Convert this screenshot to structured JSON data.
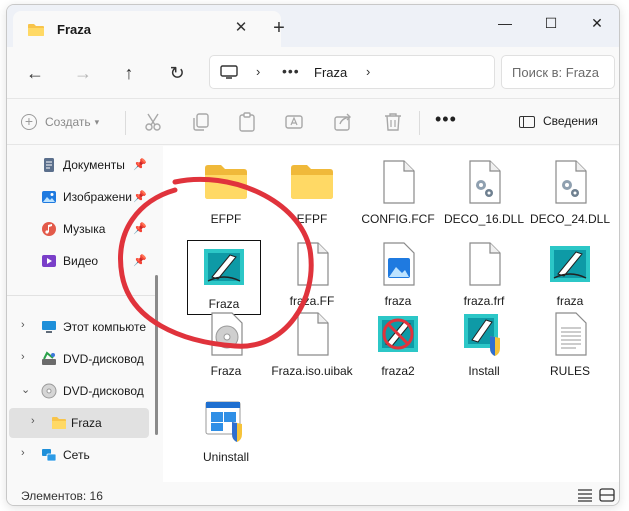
{
  "window": {
    "tab_title": "Fraza",
    "tab_close": "✕",
    "new_tab": "+",
    "minimize": "—",
    "maximize": "☐",
    "close": "✕"
  },
  "nav": {
    "back": "←",
    "forward": "→",
    "up": "↑",
    "refresh": "↻",
    "breadcrumb_more": "•••",
    "breadcrumb_segment": "Fraza",
    "breadcrumb_sep": "›",
    "search_placeholder": "Поиск в: Fraza"
  },
  "commands": {
    "create_label": "Создать",
    "more": "•••",
    "details_label": "Сведения"
  },
  "sidebar": {
    "quick": [
      {
        "label": "Документы",
        "icon": "documents-icon"
      },
      {
        "label": "Изображени",
        "icon": "pictures-icon"
      },
      {
        "label": "Музыка",
        "icon": "music-icon"
      },
      {
        "label": "Видео",
        "icon": "video-icon"
      }
    ],
    "tree": [
      {
        "label": "Этот компьюте",
        "icon": "this-pc-icon",
        "expander": "›"
      },
      {
        "label": "DVD-дисковод (",
        "icon": "dvd-drive-icon",
        "expander": "›"
      },
      {
        "label": "DVD-дисковод (",
        "icon": "dvd-disc-icon",
        "expander": "⌄"
      },
      {
        "label": "Fraza",
        "icon": "folder-icon",
        "expander": "›",
        "selected": true
      },
      {
        "label": "Сеть",
        "icon": "network-icon",
        "expander": "›"
      }
    ]
  },
  "files": [
    {
      "name": "EFPF",
      "icon": "folder-icon"
    },
    {
      "name": "EFPF",
      "icon": "folder-icon"
    },
    {
      "name": "CONFIG.FCF",
      "icon": "blank-file-icon"
    },
    {
      "name": "DECO_16.DLL",
      "icon": "dll-file-icon"
    },
    {
      "name": "DECO_24.DLL",
      "icon": "dll-file-icon"
    },
    {
      "name": "Fraza",
      "icon": "fraza-app-icon",
      "selected": true
    },
    {
      "name": "fraza.FF",
      "icon": "blank-file-icon"
    },
    {
      "name": "fraza",
      "icon": "image-file-icon"
    },
    {
      "name": "fraza.frf",
      "icon": "blank-file-icon"
    },
    {
      "name": "fraza",
      "icon": "fraza-app-icon"
    },
    {
      "name": "Fraza",
      "icon": "cd-icon"
    },
    {
      "name": "Fraza.iso.uibak",
      "icon": "blank-file-icon"
    },
    {
      "name": "fraza2",
      "icon": "fraza2-app-icon"
    },
    {
      "name": "Install",
      "icon": "installer-icon"
    },
    {
      "name": "RULES",
      "icon": "text-file-icon"
    },
    {
      "name": "Uninstall",
      "icon": "uninstall-icon"
    }
  ],
  "status": {
    "count_text": "Элементов: 16"
  },
  "colors": {
    "accent": "#0067c0",
    "folder": "#f8c44a",
    "annotation": "#e0333c"
  }
}
